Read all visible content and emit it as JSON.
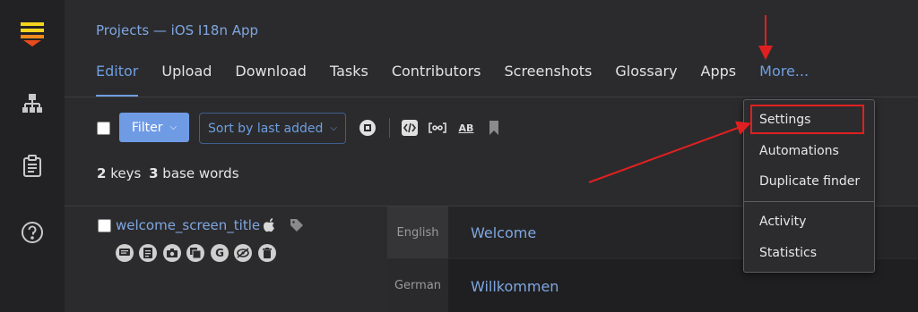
{
  "colors": {
    "accent": "#6f9ee0",
    "annotation": "#e02020",
    "filter_button": "#6f9be5"
  },
  "sidebar": {
    "icons": [
      "logo-icon",
      "hierarchy-icon",
      "clipboard-icon",
      "help-icon"
    ]
  },
  "breadcrumb": "Projects — iOS I18n App",
  "tabs": [
    "Editor",
    "Upload",
    "Download",
    "Tasks",
    "Contributors",
    "Screenshots",
    "Glossary",
    "Apps",
    "More..."
  ],
  "toolbar": {
    "filter_label": "Filter",
    "sort_prefix": "Sort by ",
    "sort_value": "last added",
    "ab_label": "AB"
  },
  "counts": {
    "keys_num": "2",
    "keys_label": "keys",
    "words_num": "3",
    "words_label": "base words"
  },
  "key": {
    "name": "welcome_screen_title"
  },
  "translations": [
    {
      "language": "English",
      "value": "Welcome"
    },
    {
      "language": "German",
      "value": "Willkommen"
    }
  ],
  "menu": {
    "items": [
      "Settings",
      "Automations",
      "Duplicate finder",
      "Activity",
      "Statistics"
    ]
  }
}
